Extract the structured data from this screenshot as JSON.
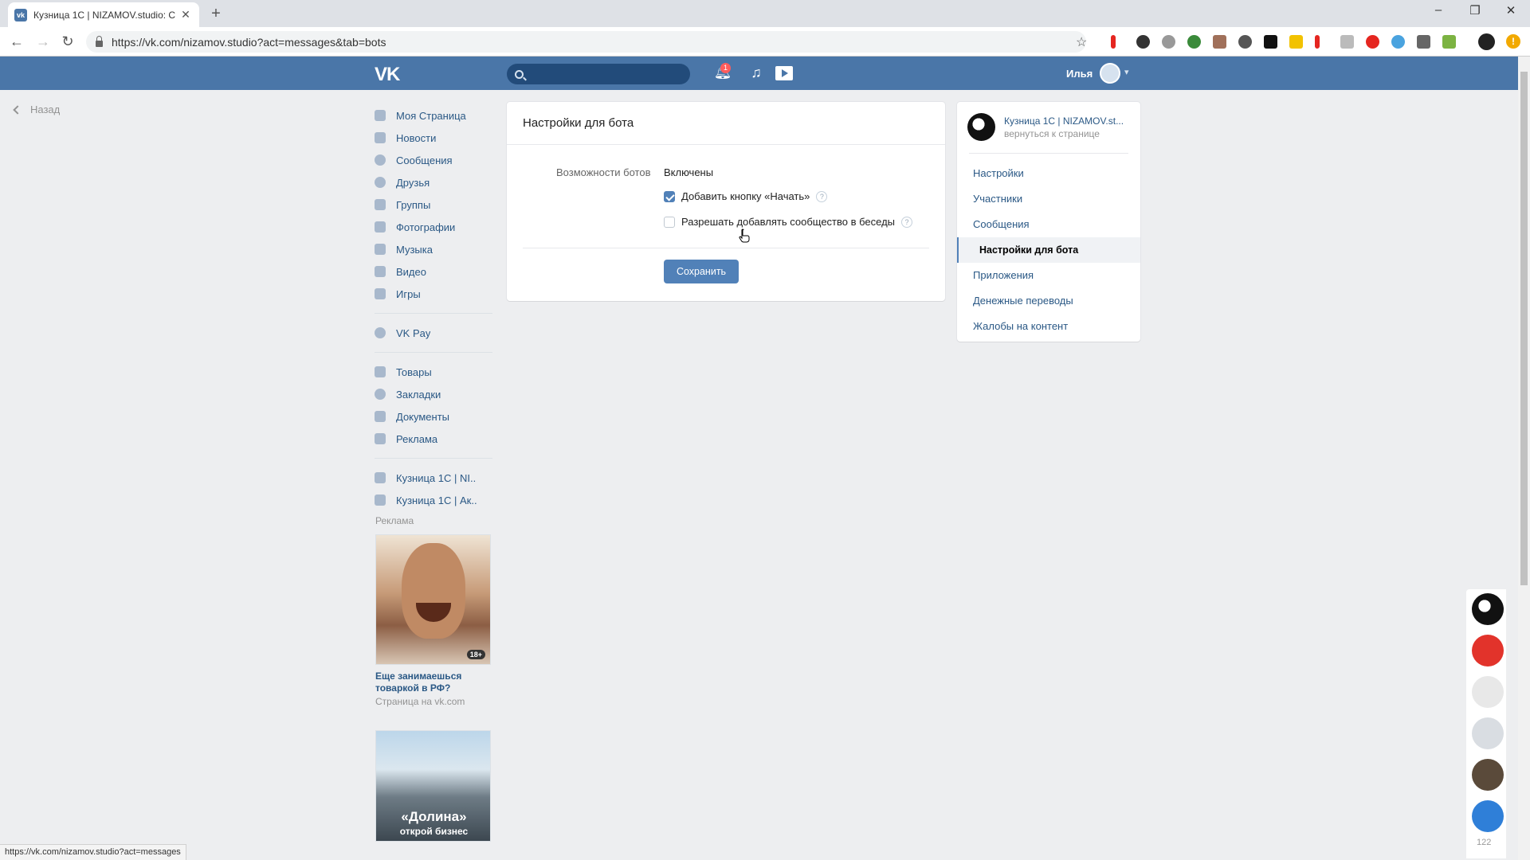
{
  "browser": {
    "tab_title": "Кузница 1С | NIZAMOV.studio: С",
    "url": "https://vk.com/nizamov.studio?act=messages&tab=bots",
    "status_url": "https://vk.com/nizamov.studio?act=messages"
  },
  "header": {
    "logo": "VK",
    "search_placeholder": "",
    "notifications_count": "1",
    "user_name": "Илья"
  },
  "back_link": "Назад",
  "left_menu": {
    "main": [
      "Моя Страница",
      "Новости",
      "Сообщения",
      "Друзья",
      "Группы",
      "Фотографии",
      "Музыка",
      "Видео",
      "Игры"
    ],
    "pay": [
      "VK Pay"
    ],
    "extra": [
      "Товары",
      "Закладки",
      "Документы",
      "Реклама"
    ],
    "communities": [
      "Кузница 1С | NI..",
      "Кузница 1С | Ак.."
    ]
  },
  "ads": {
    "section_title": "Реклама",
    "ad1": {
      "age": "18+",
      "title": "Еще занимаешься товаркой в РФ?",
      "subtitle": "Страница на vk.com"
    },
    "ad2": {
      "title": "«Долина»",
      "subtitle": "открой бизнес"
    }
  },
  "panel": {
    "title": "Настройки для бота",
    "bots_label": "Возможности ботов",
    "bots_value": "Включены",
    "option_start": "Добавить кнопку «Начать»",
    "option_start_checked": true,
    "option_chats": "Разрешать добавлять сообщество в беседы",
    "option_chats_checked": false,
    "help_glyph": "?",
    "save_label": "Сохранить"
  },
  "right_panel": {
    "community_name": "Кузница 1С | NIZAMOV.st...",
    "back_to_page": "вернуться к странице",
    "items": [
      "Настройки",
      "Участники",
      "Сообщения",
      "Настройки для бота",
      "Приложения",
      "Денежные переводы",
      "Жалобы на контент"
    ],
    "active_item": "Настройки для бота"
  },
  "chats": {
    "count": "122"
  },
  "colors": {
    "vk_blue": "#4a76a8",
    "button_blue": "#5181b8",
    "link": "#2a5885"
  }
}
